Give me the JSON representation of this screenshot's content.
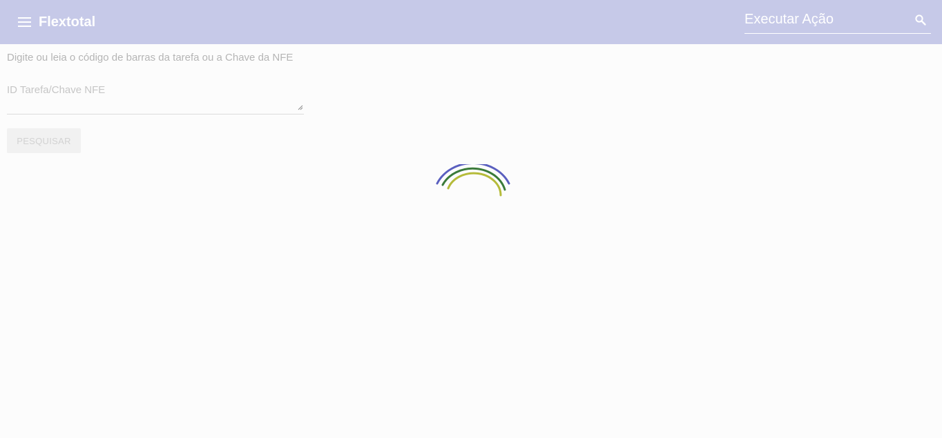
{
  "header": {
    "app_title": "Flextotal",
    "action_placeholder": "Executar Ação",
    "icons": {
      "menu": "menu-icon",
      "search": "search-icon"
    }
  },
  "main": {
    "instruction": "Digite ou leia o código de barras da tarefa ou a Chave da NFE",
    "task_input": {
      "placeholder": "ID Tarefa/Chave NFE",
      "value": ""
    },
    "search_button_label": "PESQUISAR"
  },
  "loader": {
    "colors": [
      "#5a5fbf",
      "#3a7a3a",
      "#b5bb3a"
    ]
  },
  "colors": {
    "header_bg": "#c6c9e8",
    "page_bg": "#fcfcfc"
  }
}
